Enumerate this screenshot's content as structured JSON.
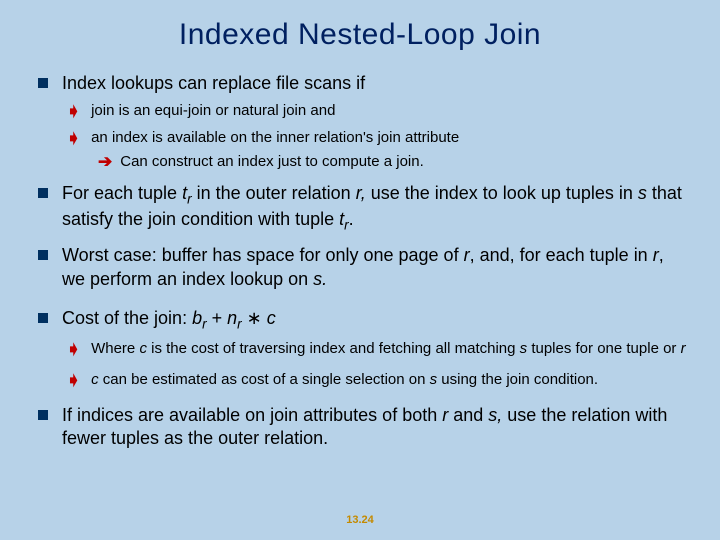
{
  "title": "Indexed Nested-Loop Join",
  "b1": "Index lookups can replace file scans if",
  "b1a": "join is an equi-join or natural join and",
  "b1b": "an index is available on the inner relation's join attribute",
  "b1b1": "Can construct an index just to compute a join.",
  "b2_pre": "For each tuple ",
  "b2_tr": "t",
  "b2_sub": "r",
  "b2_mid1": " in the outer relation ",
  "b2_r": "r,",
  "b2_mid2": " use the index to look up tuples in ",
  "b2_s": "s",
  "b2_mid3": " that satisfy the join condition with tuple ",
  "b2_tr2": "t",
  "b2_sub2": "r",
  "b2_end": ".",
  "b3_pre": "Worst case:  buffer has space for only one page of ",
  "b3_r": "r",
  "b3_mid1": ", and, for each tuple in ",
  "b3_r2": "r",
  "b3_mid2": ", we perform an index lookup on ",
  "b3_s": "s.",
  "b4_pre": "Cost of the join:  ",
  "b4_br": "b",
  "b4_brsub": "r",
  "b4_plus": "  + ",
  "b4_nr": "n",
  "b4_nrsub": "r",
  "b4_star": " ∗ ",
  "b4_c": "c",
  "b4a_pre": "Where ",
  "b4a_c": "c",
  "b4a_mid": " is the cost of traversing index and fetching all matching ",
  "b4a_s": "s",
  "b4a_mid2": " tuples for one tuple or ",
  "b4a_r": "r",
  "b4b_c": "c",
  "b4b_mid": " can be estimated as cost of a single selection on ",
  "b4b_s": "s",
  "b4b_end": " using the join condition.",
  "b5_pre": "If indices are available on join attributes of both ",
  "b5_r": "r",
  "b5_and": " and ",
  "b5_s": "s,",
  "b5_end": " use the relation with fewer tuples as the outer relation.",
  "footer": "13.24"
}
